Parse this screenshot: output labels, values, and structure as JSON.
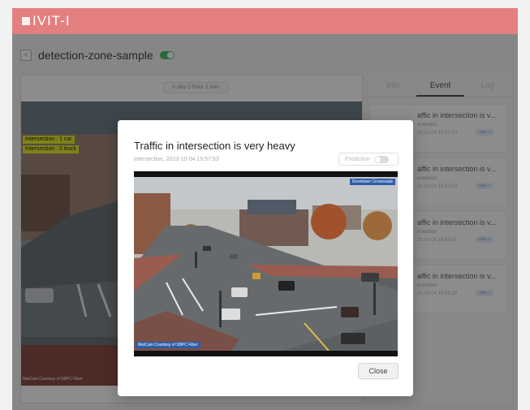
{
  "app": {
    "logo_text": "IVIT-I"
  },
  "breadcrumb": {
    "title": "detection-zone-sample"
  },
  "video": {
    "duration": "0 day 0 hour 1 min",
    "overlays": [
      "Intersection : 1 car",
      "Intersection : 0 truck"
    ],
    "watermark": "MetCam Courtesy of SBPC Fiber"
  },
  "side_panel": {
    "tabs": [
      {
        "label": "Info",
        "active": false
      },
      {
        "label": "Event",
        "active": true
      },
      {
        "label": "Log",
        "active": false
      }
    ],
    "events": [
      {
        "title": "affic in intersection is v...",
        "sub": "ersection",
        "time": "23-10-04 15:57:53",
        "view_label": "view »"
      },
      {
        "title": "affic in intersection is v...",
        "sub": "ersection",
        "time": "23-10-04 15:57:23",
        "view_label": "view »"
      },
      {
        "title": "affic in intersection is v...",
        "sub": "ersection",
        "time": "23-10-04 15:56:51",
        "view_label": "view »"
      },
      {
        "title": "affic in intersection is v...",
        "sub": "ersection",
        "time": "23-10-04 15:56:19",
        "view_label": "view »"
      }
    ]
  },
  "modal": {
    "title": "Traffic in intersection is very heavy",
    "subtitle": "intersection, 2023-10-04 15:57:53",
    "prediction_label": "Prediction",
    "prediction_enabled": false,
    "camera_logo": "Downtown Crossroads",
    "camera_watermark": "MetCam Courtesy of SBPC Fiber",
    "close_label": "Close"
  },
  "colors": {
    "header": "#e47f80",
    "toggle_on": "#4cbf6a",
    "overlay_tag": "#e9ec2e"
  }
}
